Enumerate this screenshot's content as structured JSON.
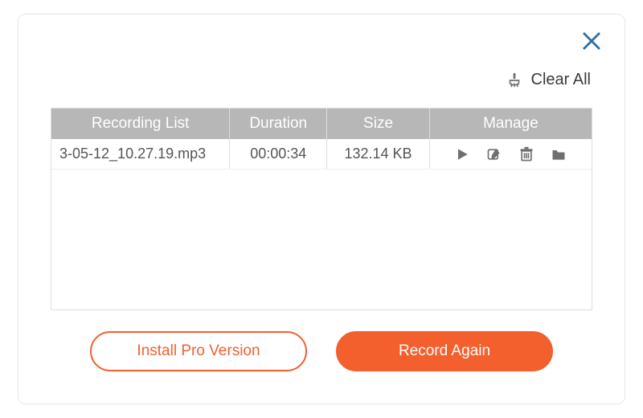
{
  "dialog": {
    "close_name": "close-icon"
  },
  "toolbar": {
    "clear_label": "Clear All"
  },
  "table": {
    "headers": {
      "recording_list": "Recording List",
      "duration": "Duration",
      "size": "Size",
      "manage": "Manage"
    },
    "rows": [
      {
        "filename": "3-05-12_10.27.19.mp3",
        "duration": "00:00:34",
        "size": "132.14 KB"
      }
    ]
  },
  "buttons": {
    "install_pro": "Install Pro Version",
    "record_again": "Record Again"
  }
}
